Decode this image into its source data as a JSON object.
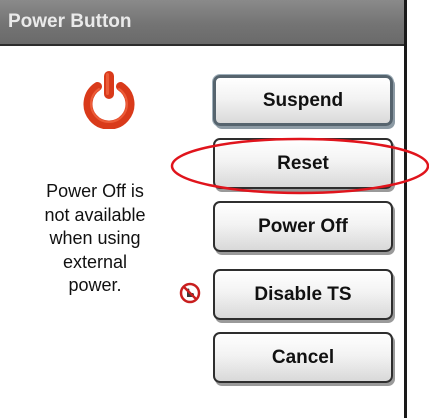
{
  "dialog": {
    "title": "Power Button",
    "message": "Power Off is\nnot available\nwhen using\nexternal\npower."
  },
  "buttons": {
    "suspend": "Suspend",
    "reset": "Reset",
    "power_off": "Power Off",
    "disable_ts": "Disable TS",
    "cancel": "Cancel"
  },
  "icons": {
    "power": "power-icon",
    "touchscreen_disabled": "no-touch-icon"
  },
  "colors": {
    "power_icon": "#d93a1a",
    "annotation_ellipse": "#e0141c",
    "titlebar": "#7a7a7a"
  }
}
